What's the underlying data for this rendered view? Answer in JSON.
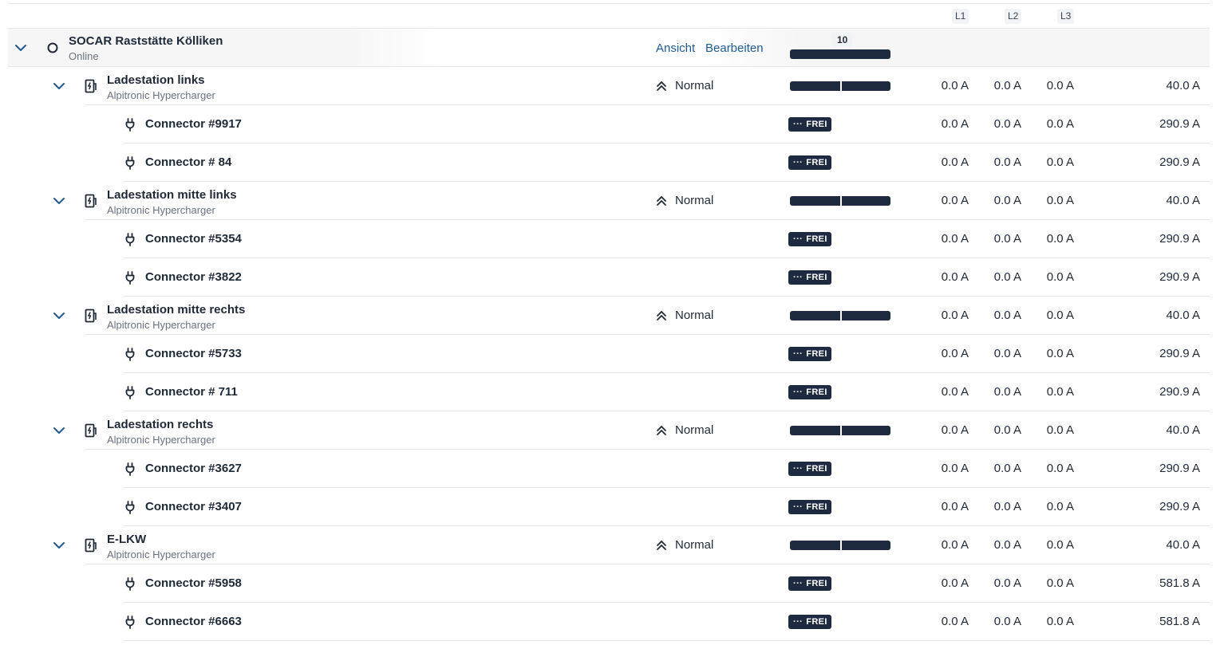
{
  "header": {
    "phases": [
      "L1",
      "L2",
      "L3"
    ]
  },
  "site": {
    "name": "SOCAR Raststätte Kölliken",
    "status": "Online",
    "view_label": "Ansicht",
    "edit_label": "Bearbeiten",
    "count": "10"
  },
  "stations": [
    {
      "name": "Ladestation links",
      "model": "Alpitronic Hypercharger",
      "mode": "Normal",
      "l1": "0.0 A",
      "l2": "0.0 A",
      "l3": "0.0 A",
      "limit": "40.0 A",
      "connectors": [
        {
          "name": "Connector #9917",
          "status": "FREI",
          "l1": "0.0 A",
          "l2": "0.0 A",
          "l3": "0.0 A",
          "limit": "290.9 A"
        },
        {
          "name": "Connector # 84",
          "status": "FREI",
          "l1": "0.0 A",
          "l2": "0.0 A",
          "l3": "0.0 A",
          "limit": "290.9 A"
        }
      ]
    },
    {
      "name": "Ladestation mitte links",
      "model": "Alpitronic Hypercharger",
      "mode": "Normal",
      "l1": "0.0 A",
      "l2": "0.0 A",
      "l3": "0.0 A",
      "limit": "40.0 A",
      "connectors": [
        {
          "name": "Connector #5354",
          "status": "FREI",
          "l1": "0.0 A",
          "l2": "0.0 A",
          "l3": "0.0 A",
          "limit": "290.9 A"
        },
        {
          "name": "Connector #3822",
          "status": "FREI",
          "l1": "0.0 A",
          "l2": "0.0 A",
          "l3": "0.0 A",
          "limit": "290.9 A"
        }
      ]
    },
    {
      "name": "Ladestation mitte rechts",
      "model": "Alpitronic Hypercharger",
      "mode": "Normal",
      "l1": "0.0 A",
      "l2": "0.0 A",
      "l3": "0.0 A",
      "limit": "40.0 A",
      "connectors": [
        {
          "name": "Connector #5733",
          "status": "FREI",
          "l1": "0.0 A",
          "l2": "0.0 A",
          "l3": "0.0 A",
          "limit": "290.9 A"
        },
        {
          "name": "Connector # 711",
          "status": "FREI",
          "l1": "0.0 A",
          "l2": "0.0 A",
          "l3": "0.0 A",
          "limit": "290.9 A"
        }
      ]
    },
    {
      "name": "Ladestation rechts",
      "model": "Alpitronic Hypercharger",
      "mode": "Normal",
      "l1": "0.0 A",
      "l2": "0.0 A",
      "l3": "0.0 A",
      "limit": "40.0 A",
      "connectors": [
        {
          "name": "Connector #3627",
          "status": "FREI",
          "l1": "0.0 A",
          "l2": "0.0 A",
          "l3": "0.0 A",
          "limit": "290.9 A"
        },
        {
          "name": "Connector #3407",
          "status": "FREI",
          "l1": "0.0 A",
          "l2": "0.0 A",
          "l3": "0.0 A",
          "limit": "290.9 A"
        }
      ]
    },
    {
      "name": "E-LKW",
      "model": "Alpitronic Hypercharger",
      "mode": "Normal",
      "l1": "0.0 A",
      "l2": "0.0 A",
      "l3": "0.0 A",
      "limit": "40.0 A",
      "connectors": [
        {
          "name": "Connector #5958",
          "status": "FREI",
          "l1": "0.0 A",
          "l2": "0.0 A",
          "l3": "0.0 A",
          "limit": "581.8 A"
        },
        {
          "name": "Connector #6663",
          "status": "FREI",
          "l1": "0.0 A",
          "l2": "0.0 A",
          "l3": "0.0 A",
          "limit": "581.8 A"
        }
      ]
    }
  ],
  "icons": {
    "expand": "chevron-down-icon",
    "site_status": "status-ring-icon",
    "station": "charging-station-icon",
    "connector": "plug-icon",
    "mode": "double-chevron-up-icon",
    "badge": "ellipsis-icon"
  },
  "colors": {
    "bar": "#1e2a3f",
    "link": "#1f5a93",
    "chevron": "#1f5a93"
  }
}
